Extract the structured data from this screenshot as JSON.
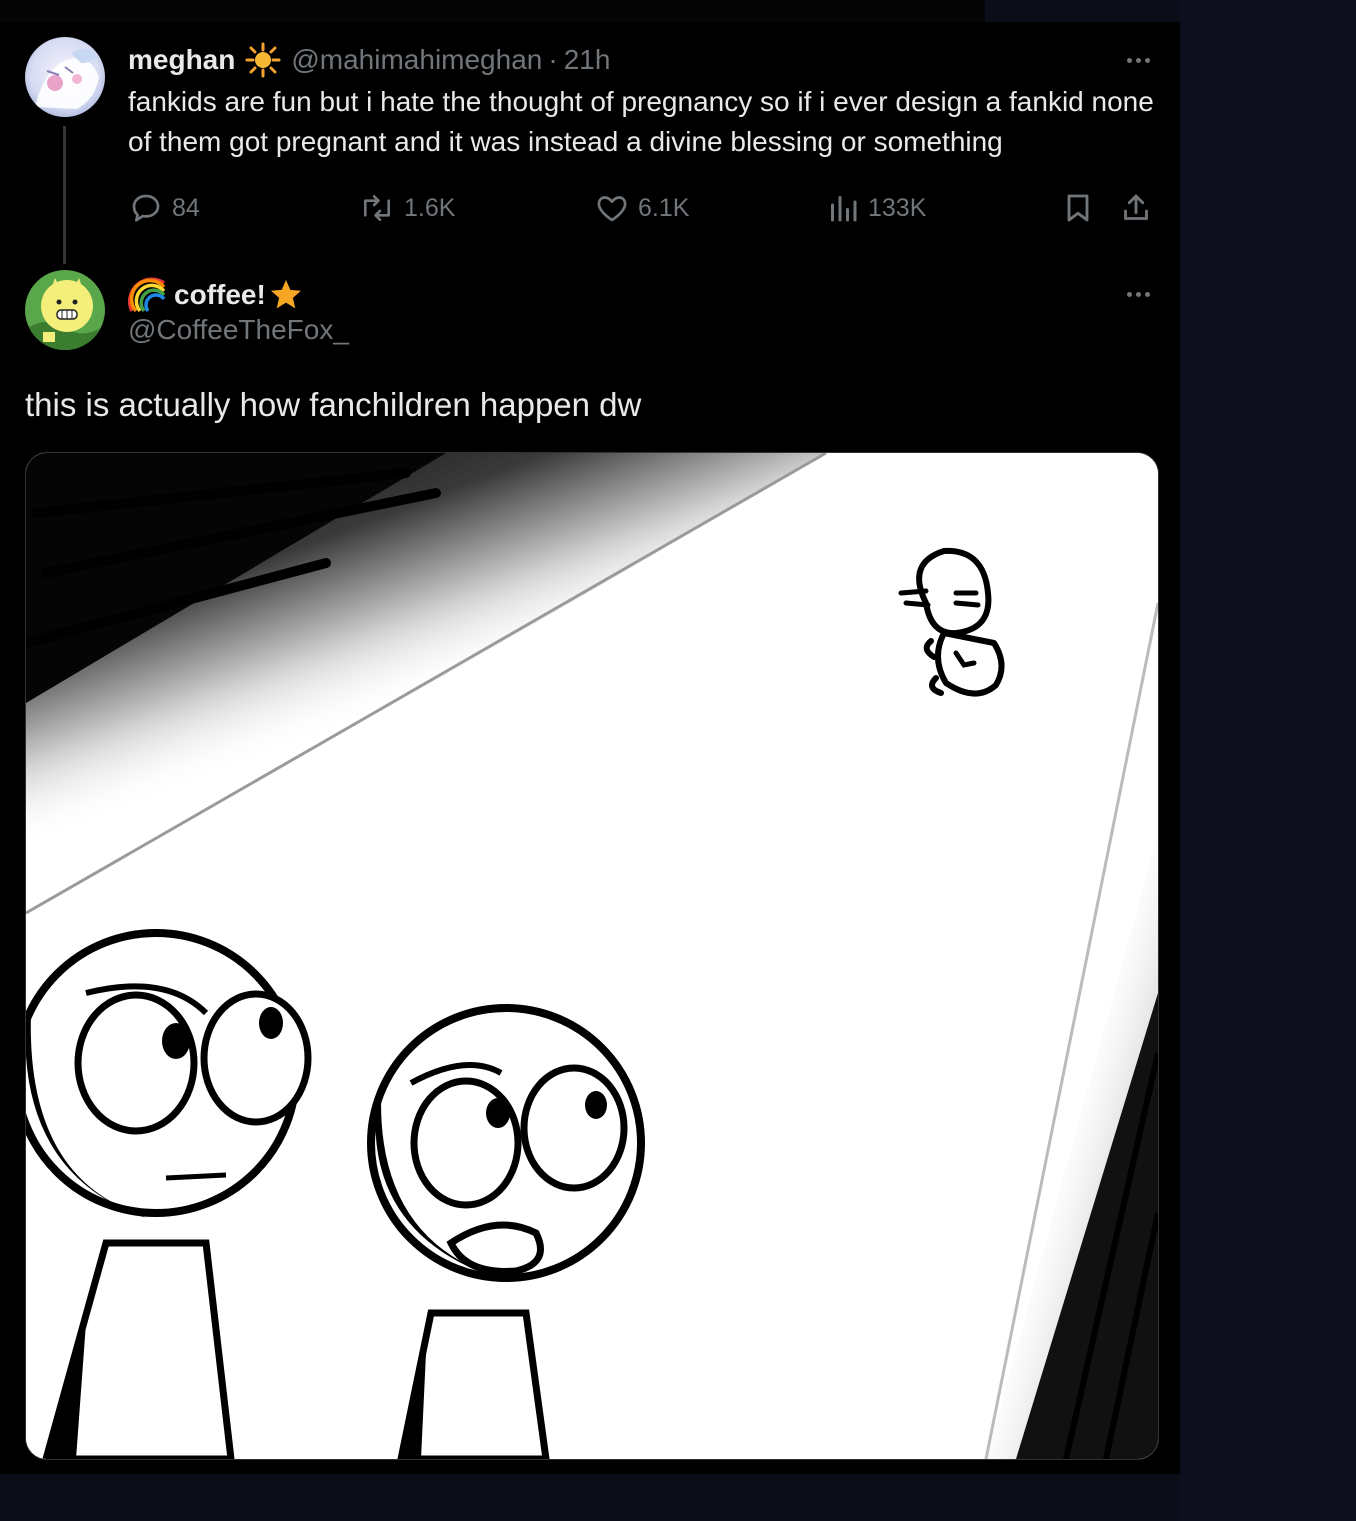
{
  "reply_parent": {
    "display_name": "meghan",
    "name_badge_emoji": "☀",
    "handle": "@mahimahimeghan",
    "separator": "·",
    "time": "21h",
    "text": "fankids are fun but i hate the thought of pregnancy so if i ever design a fankid none of them got pregnant and it was instead a divine blessing or something",
    "stats": {
      "replies": "84",
      "reposts": "1.6K",
      "likes": "6.1K",
      "views": "133K"
    },
    "icons": [
      "reply-icon",
      "repost-icon",
      "like-icon",
      "views-icon",
      "bookmark-icon",
      "share-icon",
      "more-icon"
    ]
  },
  "main_tweet": {
    "name_prefix_emoji": "🌈",
    "display_name": "coffee!",
    "name_suffix_emoji": "★",
    "handle": "@CoffeeTheFox_",
    "text": "this is actually how fanchildren happen dw",
    "media": "comic drawing: two round-headed characters looking up at a small baby figure descending in a beam of light"
  },
  "colors": {
    "page_bg": "#0b0d18",
    "feed_bg": "#000000",
    "text_primary": "#e7e9ea",
    "text_secondary": "#71767b",
    "sun_badge": "#f4a22b",
    "star_badge": "#f6a623"
  }
}
